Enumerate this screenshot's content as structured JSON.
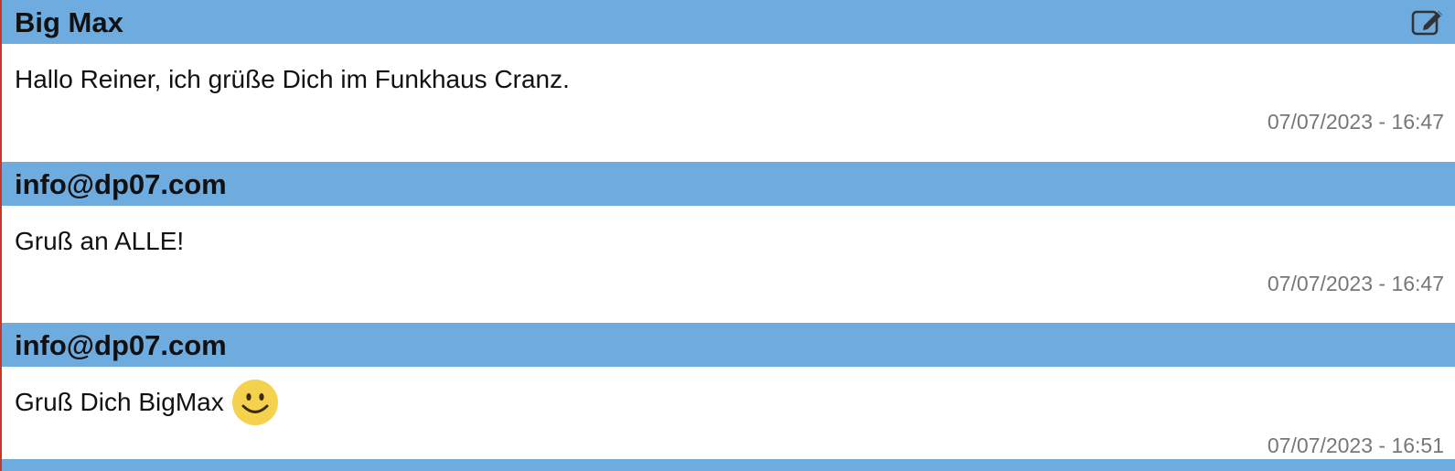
{
  "messages": [
    {
      "author": "Big Max",
      "text": "Hallo Reiner, ich grüße Dich im Funkhaus Cranz.",
      "time": "07/07/2023 - 16:47",
      "has_edit": true,
      "has_smiley": false
    },
    {
      "author": "info@dp07.com",
      "text": "Gruß an ALLE!",
      "time": "07/07/2023 - 16:47",
      "has_edit": false,
      "has_smiley": false
    },
    {
      "author": "info@dp07.com",
      "text": "Gruß Dich BigMax",
      "time": "07/07/2023 - 16:51",
      "has_edit": false,
      "has_smiley": true
    }
  ],
  "icons": {
    "edit": "edit-icon",
    "smiley": "smiley-emoji-icon"
  },
  "colors": {
    "header_bg": "#6eabdf",
    "timestamp": "#777777",
    "left_border": "#c0392b",
    "smiley": "#f5d24e"
  }
}
